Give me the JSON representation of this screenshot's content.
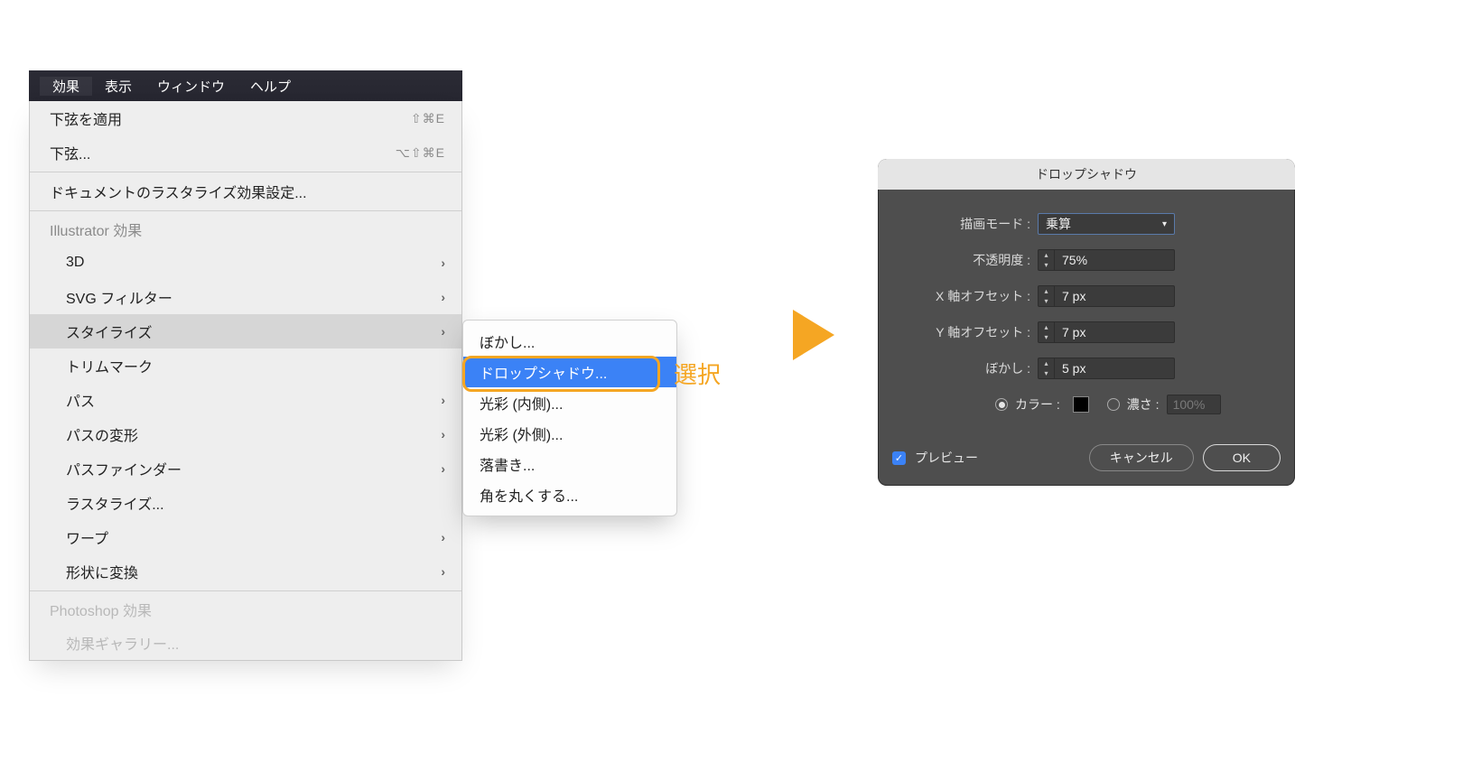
{
  "menubar": {
    "items": [
      "効果",
      "表示",
      "ウィンドウ",
      "ヘルプ"
    ]
  },
  "menu": {
    "apply_last": {
      "label": "下弦を適用",
      "shortcut": "⇧⌘E"
    },
    "last": {
      "label": "下弦...",
      "shortcut": "⌥⇧⌘E"
    },
    "raster_settings": "ドキュメントのラスタライズ効果設定...",
    "section_ai": "Illustrator 効果",
    "items_ai": [
      {
        "label": "3D",
        "sub": true
      },
      {
        "label": "SVG フィルター",
        "sub": true
      },
      {
        "label": "スタイライズ",
        "sub": true,
        "highlight": true
      },
      {
        "label": "トリムマーク",
        "sub": false
      },
      {
        "label": "パス",
        "sub": true
      },
      {
        "label": "パスの変形",
        "sub": true
      },
      {
        "label": "パスファインダー",
        "sub": true
      },
      {
        "label": "ラスタライズ...",
        "sub": false
      },
      {
        "label": "ワープ",
        "sub": true
      },
      {
        "label": "形状に変換",
        "sub": true
      }
    ],
    "section_ps": "Photoshop 効果",
    "ps_item": "効果ギャラリー..."
  },
  "submenu": {
    "items": [
      "ぼかし...",
      "ドロップシャドウ...",
      "光彩 (内側)...",
      "光彩 (外側)...",
      "落書き...",
      "角を丸くする..."
    ],
    "selected_index": 1
  },
  "annotation": "選択",
  "dialog": {
    "title": "ドロップシャドウ",
    "mode_label": "描画モード :",
    "mode_value": "乗算",
    "opacity_label": "不透明度 :",
    "opacity_value": "75%",
    "xoff_label": "X 軸オフセット :",
    "xoff_value": "7 px",
    "yoff_label": "Y 軸オフセット :",
    "yoff_value": "7 px",
    "blur_label": "ぼかし :",
    "blur_value": "5 px",
    "color_label": "カラー :",
    "darkness_label": "濃さ :",
    "darkness_value": "100%",
    "preview_label": "プレビュー",
    "cancel": "キャンセル",
    "ok": "OK"
  }
}
